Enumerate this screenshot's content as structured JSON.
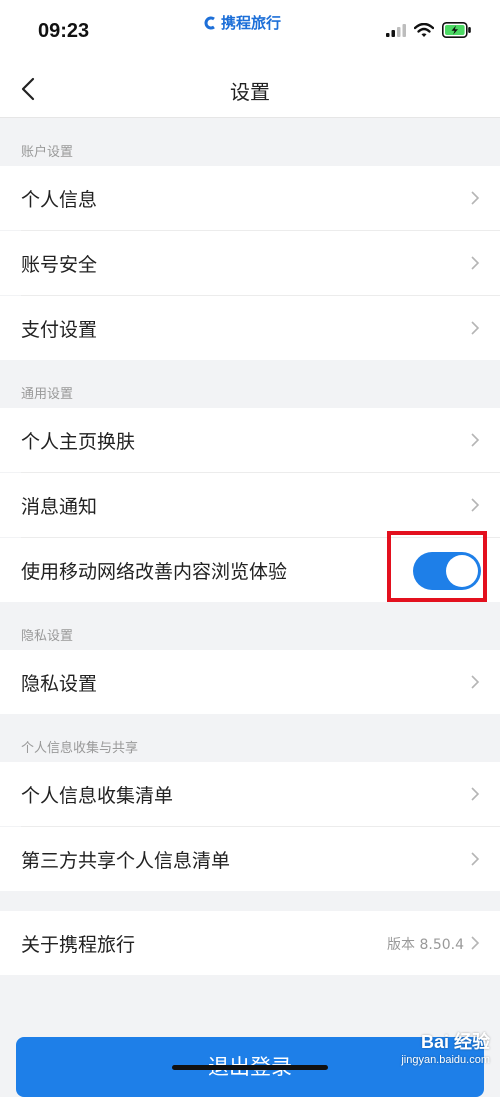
{
  "status_bar": {
    "time": "09:23",
    "brand": "携程旅行"
  },
  "nav": {
    "title": "设置"
  },
  "sections": {
    "account": {
      "header": "账户设置",
      "items": [
        {
          "label": "个人信息"
        },
        {
          "label": "账号安全"
        },
        {
          "label": "支付设置"
        }
      ]
    },
    "general": {
      "header": "通用设置",
      "items": [
        {
          "label": "个人主页换肤"
        },
        {
          "label": "消息通知"
        },
        {
          "label": "使用移动网络改善内容浏览体验",
          "toggle_on": true
        }
      ]
    },
    "privacy": {
      "header": "隐私设置",
      "items": [
        {
          "label": "隐私设置"
        }
      ]
    },
    "info": {
      "header": "个人信息收集与共享",
      "items": [
        {
          "label": "个人信息收集清单"
        },
        {
          "label": "第三方共享个人信息清单"
        }
      ]
    },
    "about": {
      "label": "关于携程旅行",
      "version": "版本 8.50.4"
    }
  },
  "logout": {
    "label": "退出登录"
  },
  "watermark": {
    "top": "Bai 经验",
    "bottom": "jingyan.baidu.com"
  },
  "colors": {
    "accent": "#1e7fe8",
    "highlight": "#e3101e",
    "battery": "#4cd964"
  }
}
